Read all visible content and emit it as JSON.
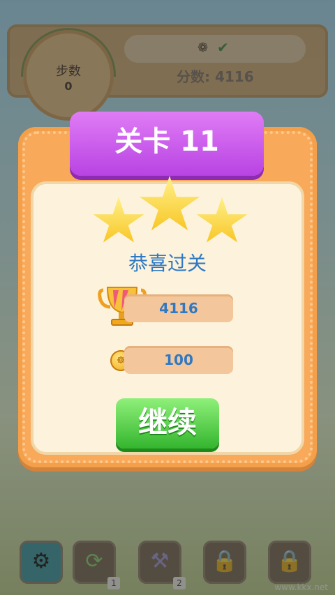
{
  "hud": {
    "steps_label": "步数",
    "steps_value": "0",
    "goal_check": "✔",
    "score_text": "分数: 4116"
  },
  "dialog": {
    "title": "关卡 11",
    "stars_earned": 3,
    "congrats": "恭喜过关",
    "score_value": "4116",
    "coin_value": "100",
    "continue_label": "继续"
  },
  "toolbar": {
    "items": [
      {
        "icon": "gear-icon"
      },
      {
        "icon": "shuffle-icon",
        "count": "1"
      },
      {
        "icon": "hammer-icon",
        "count": "2"
      },
      {
        "icon": "lock-icon"
      },
      {
        "icon": "lock-icon"
      }
    ]
  },
  "watermark": "www.kkx.net"
}
